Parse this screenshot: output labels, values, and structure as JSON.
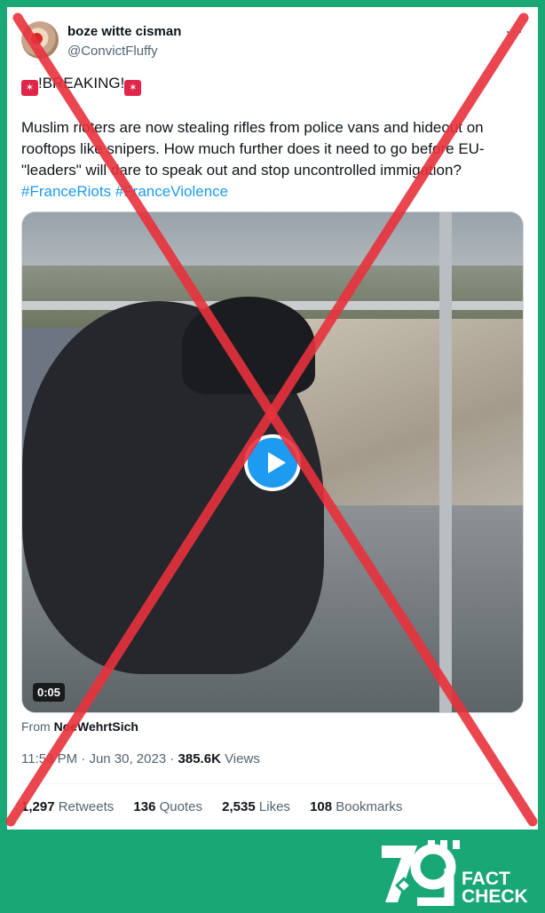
{
  "tweet": {
    "display_name": "boze witte cisman",
    "handle": "@ConvictFluffy",
    "more_label": "···",
    "headline": "!BREAKING!",
    "body": "Muslim rioters are now stealing rifles from police vans and hideout on rooftops like snipers. How much further does it need to go before EU-\"leaders\" will dare to speak out and stop uncontrolled immigation?",
    "hashtags": [
      "#FranceRiots",
      "#FranceViolence"
    ],
    "siren_icon": "police-siren-emoji"
  },
  "media": {
    "duration": "0:05",
    "play_icon": "play-icon"
  },
  "source": {
    "prefix": "From",
    "account": "NoeWehrtSich"
  },
  "meta": {
    "time": "11:53 PM",
    "date": "Jun 30, 2023",
    "views_count": "385.6K",
    "views_label": "Views",
    "separator": "·"
  },
  "stats": [
    {
      "count": "1,297",
      "label": "Retweets"
    },
    {
      "count": "136",
      "label": "Quotes"
    },
    {
      "count": "2,535",
      "label": "Likes"
    },
    {
      "count": "108",
      "label": "Bookmarks"
    }
  ],
  "overlay": {
    "cross_color": "#e8323d"
  },
  "branding": {
    "logo_line1": "FACT",
    "logo_line2": "CHECK",
    "logo_mark": "79",
    "accent": "#1aa776"
  }
}
